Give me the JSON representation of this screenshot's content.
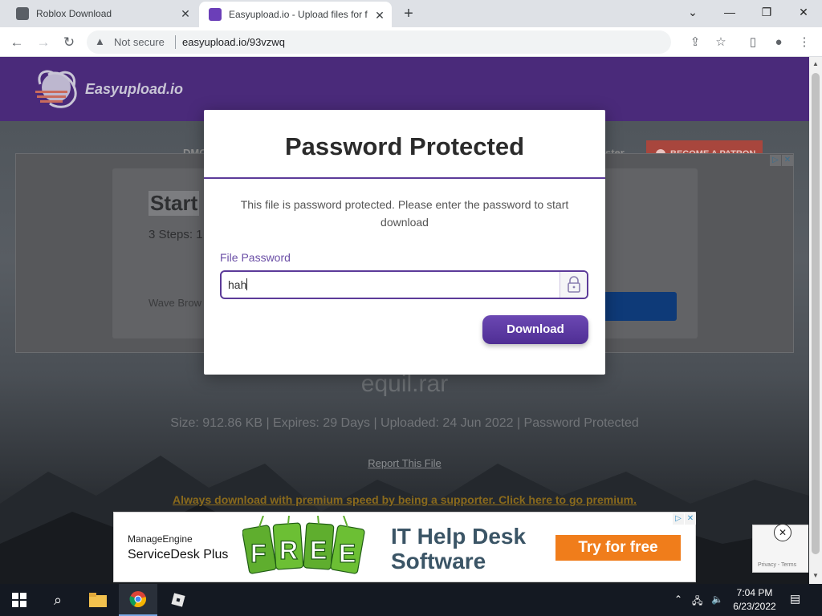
{
  "browser": {
    "tabs": [
      {
        "title": "Roblox Download"
      },
      {
        "title": "Easyupload.io - Upload files for f"
      }
    ],
    "address": {
      "security": "Not secure",
      "url": "easyupload.io/93vzwq"
    }
  },
  "site": {
    "logo_text": "Easyupload.io",
    "nav": [
      "DMC",
      "ster"
    ],
    "patron_label": "BECOME A PATRON"
  },
  "ad_top": {
    "title": "Start",
    "steps": "3 Steps: 1",
    "footer": "Wave Brow"
  },
  "file": {
    "name": "equil.rar",
    "info": "Size: 912.86 KB | Expires: 29 Days | Uploaded: 24 Jun 2022 | Password Protected",
    "report_link": "Report This File",
    "premium_link": "Always download with premium speed by being a supporter. Click here to go premium."
  },
  "modal": {
    "title": "Password Protected",
    "message": "This file is password protected. Please enter the password to start download",
    "field_label": "File Password",
    "password_value": "hah",
    "button_label": "Download"
  },
  "ad_bottom": {
    "brand": "ManageEngine",
    "product": "ServiceDesk Plus",
    "free_letters": [
      "F",
      "R",
      "E",
      "E"
    ],
    "headline_1": "IT Help Desk",
    "headline_2": "Software",
    "cta": "Try for free"
  },
  "captcha": {
    "text": "Privacy - Terms"
  },
  "taskbar": {
    "time": "7:04 PM",
    "date": "6/23/2022"
  },
  "colors": {
    "accent": "#5c3b99",
    "site_header": "#4a2a7a",
    "cta_orange": "#f07d1b"
  }
}
